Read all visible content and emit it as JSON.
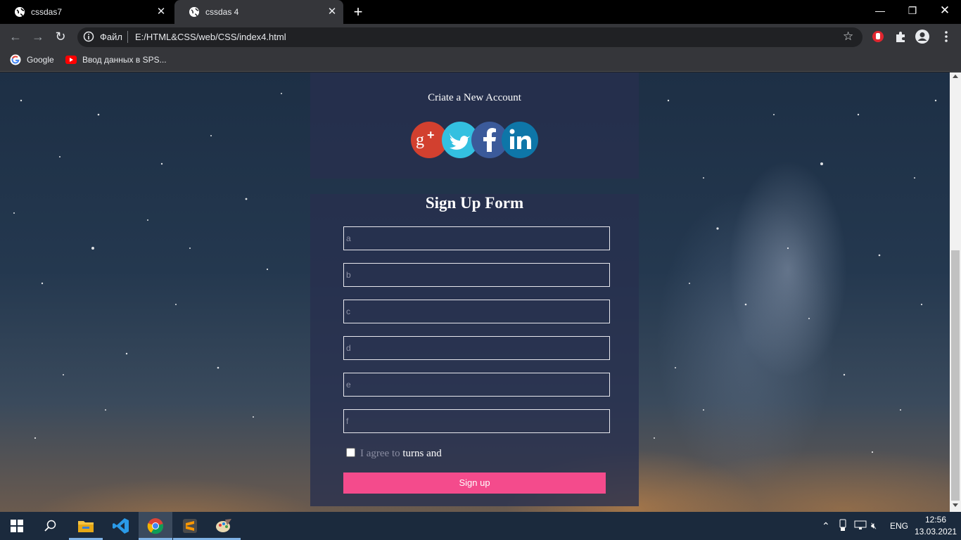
{
  "browser": {
    "tabs": [
      {
        "title": "cssdas7",
        "active": false
      },
      {
        "title": "cssdas 4",
        "active": true
      }
    ],
    "omnibox": {
      "scheme_label": "Файл",
      "url": "E:/HTML&CSS/web/CSS/index4.html"
    },
    "bookmarks": [
      {
        "label": "Google",
        "icon": "google-icon"
      },
      {
        "label": "Ввод данных в SPS...",
        "icon": "youtube-icon"
      }
    ]
  },
  "page": {
    "create_title": "Criate a New Account",
    "social_icons": [
      "google-plus-icon",
      "twitter-icon",
      "facebook-icon",
      "linkedin-icon"
    ],
    "form_title": "Sign Up Form",
    "fields": [
      {
        "placeholder": "a",
        "value": ""
      },
      {
        "placeholder": "b",
        "value": ""
      },
      {
        "placeholder": "c",
        "value": ""
      },
      {
        "placeholder": "d",
        "value": ""
      },
      {
        "placeholder": "e",
        "value": ""
      },
      {
        "placeholder": "f",
        "value": ""
      }
    ],
    "agree": {
      "muted": "I agree to",
      "bright": "turns and",
      "checked": false
    },
    "signup_label": "Sign up",
    "colors": {
      "panel": "#28304e",
      "button": "#f44b8c"
    }
  },
  "taskbar": {
    "apps": [
      "start-icon",
      "search-icon",
      "file-explorer-icon",
      "vscode-icon",
      "chrome-icon",
      "sublime-text-icon",
      "paint-icon"
    ],
    "language": "ENG",
    "time": "12:56",
    "date": "13.03.2021"
  }
}
